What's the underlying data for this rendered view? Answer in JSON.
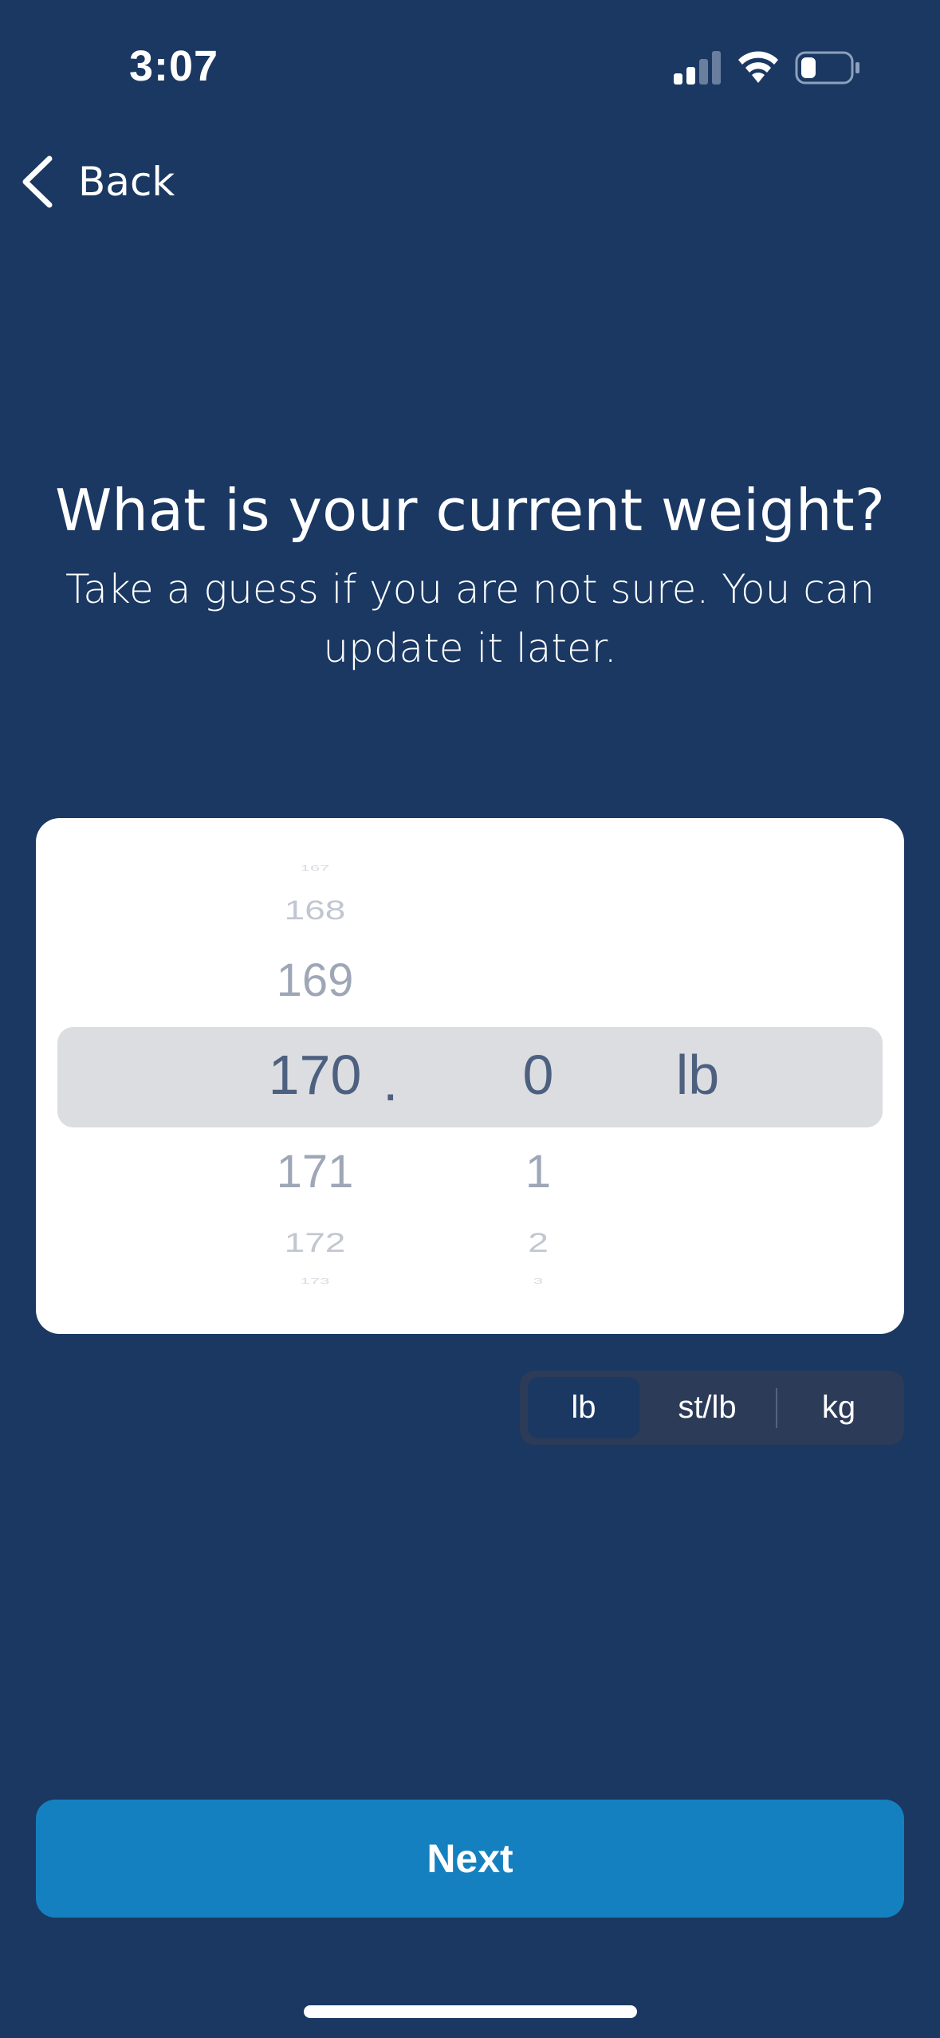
{
  "status_bar": {
    "time": "3:07",
    "icons": [
      "signal-icon",
      "wifi-icon",
      "battery-icon"
    ]
  },
  "nav": {
    "back_label": "Back",
    "back_icon": "chevron-left-icon"
  },
  "header": {
    "title": "What is your current weight?",
    "subtitle": "Take a guess if you are not sure. You can update it later."
  },
  "picker": {
    "integer_above": [
      "167",
      "168",
      "169"
    ],
    "integer_selected": "170",
    "integer_below": [
      "171",
      "172",
      "173"
    ],
    "separator": ".",
    "decimal_selected": "0",
    "decimal_below": [
      "1",
      "2",
      "3"
    ],
    "unit": "lb"
  },
  "unit_toggle": {
    "options": [
      "lb",
      "st/lb",
      "kg"
    ],
    "selected": "lb"
  },
  "next_label": "Next",
  "colors": {
    "background": "#1a3862",
    "card": "#ffffff",
    "highlight": "#dcdde0",
    "primary_button": "#1580bf",
    "toggle_bg": "#2c3b57",
    "selected_text": "#4d6080"
  }
}
